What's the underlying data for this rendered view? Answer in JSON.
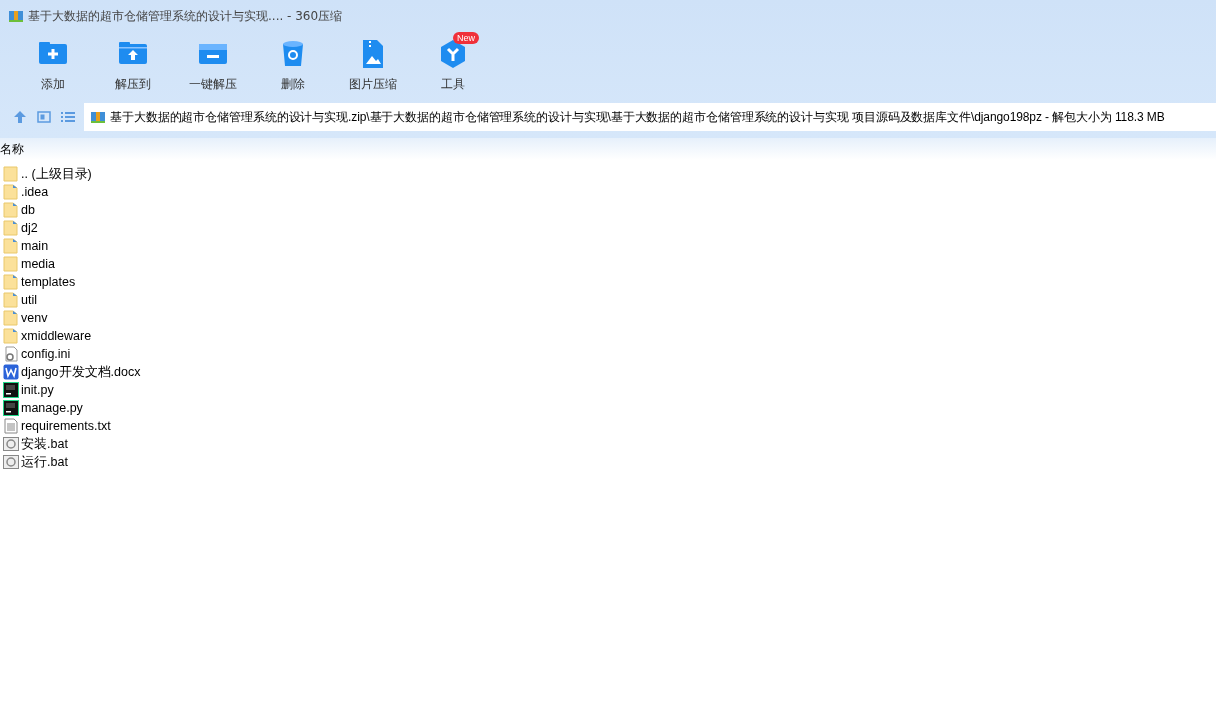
{
  "window": {
    "title": "基于大数据的超市仓储管理系统的设计与实现.... - 360压缩"
  },
  "toolbar": [
    {
      "label": "添加",
      "kind": "add"
    },
    {
      "label": "解压到",
      "kind": "extract"
    },
    {
      "label": "一键解压",
      "kind": "oneclick"
    },
    {
      "label": "删除",
      "kind": "delete"
    },
    {
      "label": "图片压缩",
      "kind": "image"
    },
    {
      "label": "工具",
      "kind": "tools",
      "badge": "New"
    }
  ],
  "address_bar": {
    "path": "基于大数据的超市仓储管理系统的设计与实现.zip\\基于大数据的超市仓储管理系统的设计与实现\\基于大数据的超市仓储管理系统的设计与实现 项目源码及数据库文件\\django198pz - 解包大小为 118.3 MB"
  },
  "file_list": {
    "columns": [
      "名称"
    ],
    "rows": [
      {
        "name": ".. (上级目录)",
        "kind": "folder-plain"
      },
      {
        "name": ".idea",
        "kind": "folder"
      },
      {
        "name": "db",
        "kind": "folder"
      },
      {
        "name": "dj2",
        "kind": "folder"
      },
      {
        "name": "main",
        "kind": "folder"
      },
      {
        "name": "media",
        "kind": "folder-plain"
      },
      {
        "name": "templates",
        "kind": "folder"
      },
      {
        "name": "util",
        "kind": "folder"
      },
      {
        "name": "venv",
        "kind": "folder"
      },
      {
        "name": "xmiddleware",
        "kind": "folder"
      },
      {
        "name": "config.ini",
        "kind": "config"
      },
      {
        "name": "django开发文档.docx",
        "kind": "word"
      },
      {
        "name": "init.py",
        "kind": "python"
      },
      {
        "name": "manage.py",
        "kind": "python"
      },
      {
        "name": "requirements.txt",
        "kind": "text"
      },
      {
        "name": "安装.bat",
        "kind": "batch"
      },
      {
        "name": "运行.bat",
        "kind": "batch"
      }
    ]
  }
}
